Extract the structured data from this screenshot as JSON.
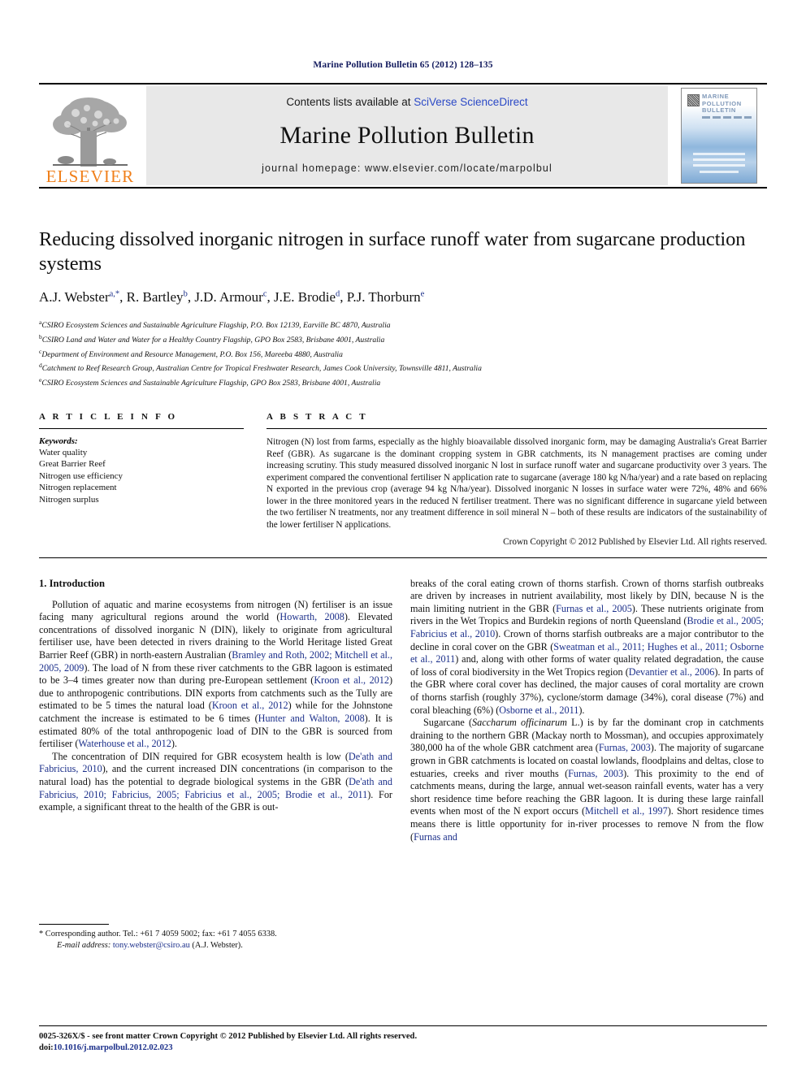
{
  "running_head": "Marine Pollution Bulletin 65 (2012) 128–135",
  "masthead": {
    "elsevier_wordmark": "ELSEVIER",
    "contents_prefix": "Contents lists available at ",
    "sciencedirect_link": "SciVerse ScienceDirect",
    "journal_name": "Marine Pollution Bulletin",
    "homepage": "journal homepage: www.elsevier.com/locate/marpolbul",
    "cover_title": "MARINE POLLUTION BULLETIN"
  },
  "article": {
    "title": "Reducing dissolved inorganic nitrogen in surface runoff water from sugarcane production systems",
    "authors": "A.J. Webster, R. Bartley, J.D. Armour, J.E. Brodie, P.J. Thorburn",
    "author_list": [
      {
        "name": "A.J. Webster",
        "sup": "a,*"
      },
      {
        "name": "R. Bartley",
        "sup": "b"
      },
      {
        "name": "J.D. Armour",
        "sup": "c"
      },
      {
        "name": "J.E. Brodie",
        "sup": "d"
      },
      {
        "name": "P.J. Thorburn",
        "sup": "e"
      }
    ],
    "affiliations": [
      {
        "marker": "a",
        "text": "CSIRO Ecosystem Sciences and Sustainable Agriculture Flagship, P.O. Box 12139, Earville BC 4870, Australia"
      },
      {
        "marker": "b",
        "text": "CSIRO Land and Water and Water for a Healthy Country Flagship, GPO Box 2583, Brisbane 4001, Australia"
      },
      {
        "marker": "c",
        "text": "Department of Environment and Resource Management, P.O. Box 156, Mareeba 4880, Australia"
      },
      {
        "marker": "d",
        "text": "Catchment to Reef Research Group, Australian Centre for Tropical Freshwater Research, James Cook University, Townsville 4811, Australia"
      },
      {
        "marker": "e",
        "text": "CSIRO Ecosystem Sciences and Sustainable Agriculture Flagship, GPO Box 2583, Brisbane 4001, Australia"
      }
    ]
  },
  "article_info": {
    "heading": "A R T I C L E    I N F O",
    "keywords_label": "Keywords:",
    "keywords": [
      "Water quality",
      "Great Barrier Reef",
      "Nitrogen use efficiency",
      "Nitrogen replacement",
      "Nitrogen surplus"
    ]
  },
  "abstract": {
    "heading": "A B S T R A C T",
    "text": "Nitrogen (N) lost from farms, especially as the highly bioavailable dissolved inorganic form, may be damaging Australia's Great Barrier Reef (GBR). As sugarcane is the dominant cropping system in GBR catchments, its N management practises are coming under increasing scrutiny. This study measured dissolved inorganic N lost in surface runoff water and sugarcane productivity over 3 years. The experiment compared the conventional fertiliser N application rate to sugarcane (average 180 kg N/ha/year) and a rate based on replacing N exported in the previous crop (average 94 kg N/ha/year). Dissolved inorganic N losses in surface water were 72%, 48% and 66% lower in the three monitored years in the reduced N fertiliser treatment. There was no significant difference in sugarcane yield between the two fertiliser N treatments, nor any treatment difference in soil mineral N – both of these results are indicators of the sustainability of the lower fertiliser N applications.",
    "copyright": "Crown Copyright © 2012 Published by Elsevier Ltd. All rights reserved."
  },
  "introduction": {
    "heading": "1. Introduction",
    "left_paragraphs": [
      "Pollution of aquatic and marine ecosystems from nitrogen (N) fertiliser is an issue facing many agricultural regions around the world (Howarth, 2008). Elevated concentrations of dissolved inorganic N (DIN), likely to originate from agricultural fertiliser use, have been detected in rivers draining to the World Heritage listed Great Barrier Reef (GBR) in north-eastern Australian (Bramley and Roth, 2002; Mitchell et al., 2005, 2009). The load of N from these river catchments to the GBR lagoon is estimated to be 3–4 times greater now than during pre-European settlement (Kroon et al., 2012) due to anthropogenic contributions. DIN exports from catchments such as the Tully are estimated to be 5 times the natural load (Kroon et al., 2012) while for the Johnstone catchment the increase is estimated to be 6 times (Hunter and Walton, 2008). It is estimated 80% of the total anthropogenic load of DIN to the GBR is sourced from fertiliser (Waterhouse et al., 2012).",
      "The concentration of DIN required for GBR ecosystem health is low (De'ath and Fabricius, 2010), and the current increased DIN concentrations (in comparison to the natural load) has the potential to degrade biological systems in the GBR (De'ath and Fabricius, 2010; Fabricius, 2005; Fabricius et al., 2005; Brodie et al., 2011). For example, a significant threat to the health of the GBR is out-"
    ],
    "right_paragraphs": [
      "breaks of the coral eating crown of thorns starfish. Crown of thorns starfish outbreaks are driven by increases in nutrient availability, most likely by DIN, because N is the main limiting nutrient in the GBR (Furnas et al., 2005). These nutrients originate from rivers in the Wet Tropics and Burdekin regions of north Queensland (Brodie et al., 2005; Fabricius et al., 2010). Crown of thorns starfish outbreaks are a major contributor to the decline in coral cover on the GBR (Sweatman et al., 2011; Hughes et al., 2011; Osborne et al., 2011) and, along with other forms of water quality related degradation, the cause of loss of coral biodiversity in the Wet Tropics region (Devantier et al., 2006). In parts of the GBR where coral cover has declined, the major causes of coral mortality are crown of thorns starfish (roughly 37%), cyclone/storm damage (34%), coral disease (7%) and coral bleaching (6%) (Osborne et al., 2011).",
      "Sugarcane (Saccharum officinarum L.) is by far the dominant crop in catchments draining to the northern GBR (Mackay north to Mossman), and occupies approximately 380,000 ha of the whole GBR catchment area (Furnas, 2003). The majority of sugarcane grown in GBR catchments is located on coastal lowlands, floodplains and deltas, close to estuaries, creeks and river mouths (Furnas, 2003). This proximity to the end of catchments means, during the large, annual wet-season rainfall events, water has a very short residence time before reaching the GBR lagoon. It is during these large rainfall events when most of the N export occurs (Mitchell et al., 1997). Short residence times means there is little opportunity for in-river processes to remove N from the flow (Furnas and"
    ]
  },
  "footnote": {
    "corresponding": "* Corresponding author. Tel.: +61 7 4059 5002; fax: +61 7 4055 6338.",
    "email_label": "E-mail address:",
    "email": "tony.webster@csiro.au",
    "email_suffix": "(A.J. Webster)."
  },
  "page_footer": {
    "line1": "0025-326X/$ - see front matter Crown Copyright © 2012 Published by Elsevier Ltd. All rights reserved.",
    "doi_label": "doi:",
    "doi": "10.1016/j.marpolbul.2012.02.023"
  }
}
